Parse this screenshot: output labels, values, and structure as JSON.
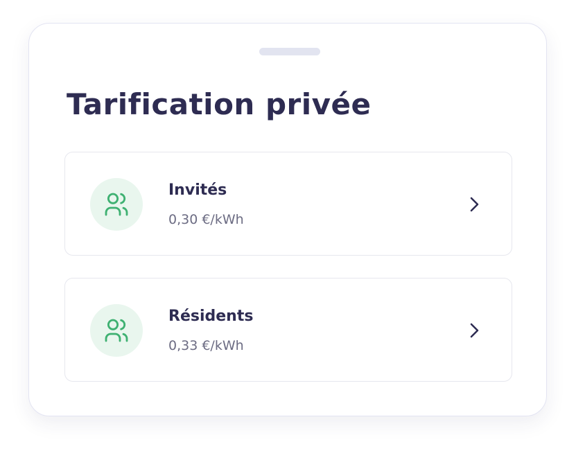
{
  "sheet": {
    "title": "Tarification privée"
  },
  "tariffs": [
    {
      "label": "Invités",
      "price": "0,30 €/kWh",
      "icon": "users-icon"
    },
    {
      "label": "Résidents",
      "price": "0,33 €/kWh",
      "icon": "users-icon"
    }
  ],
  "colors": {
    "title_text": "#2e2c52",
    "muted_text": "#6c6c83",
    "icon_accent": "#3fb172",
    "icon_background": "#e9f6ee",
    "card_border": "#e6e7ee"
  }
}
